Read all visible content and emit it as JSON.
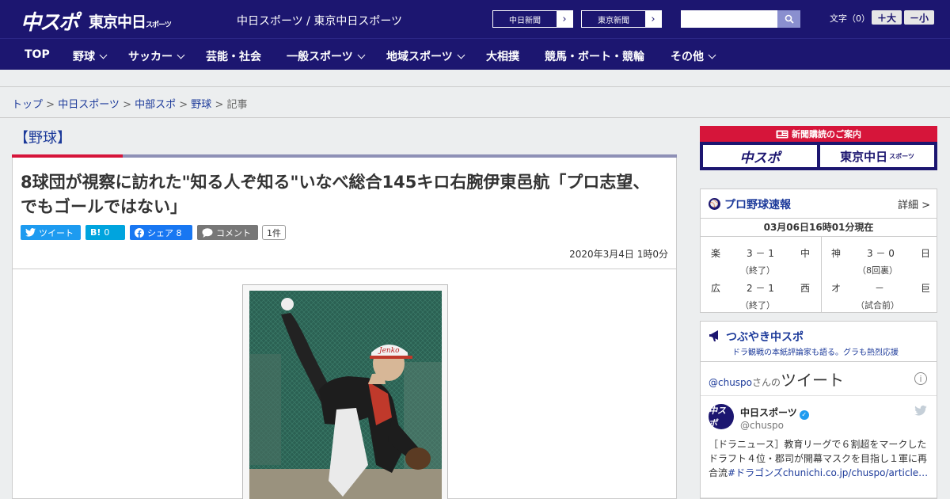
{
  "header": {
    "logo_primary": "中スポ",
    "logo_secondary": "東京中日",
    "logo_secondary_small": "スポーツ",
    "site_links": "中日スポーツ / 東京中日スポーツ",
    "btn_chunichi": "中日新聞",
    "btn_tokyo": "東京新聞",
    "search_placeholder": "",
    "font_size_label": "文字（0）",
    "font_plus": "＋大",
    "font_minus": "－小"
  },
  "nav": [
    {
      "label": "TOP",
      "dropdown": false
    },
    {
      "label": "野球",
      "dropdown": true
    },
    {
      "label": "サッカー",
      "dropdown": true
    },
    {
      "label": "芸能・社会",
      "dropdown": false
    },
    {
      "label": "一般スポーツ",
      "dropdown": true
    },
    {
      "label": "地域スポーツ",
      "dropdown": true
    },
    {
      "label": "大相撲",
      "dropdown": false
    },
    {
      "label": "競馬・ボート・競輪",
      "dropdown": false
    },
    {
      "label": "その他",
      "dropdown": true
    }
  ],
  "breadcrumb": {
    "items": [
      "トップ",
      "中日スポーツ",
      "中部スポ",
      "野球"
    ],
    "current": "記事",
    "sep": " > "
  },
  "article": {
    "category": "【野球】",
    "title": "8球団が視察に訪れた\"知る人ぞ知る\"いなべ総合145キロ右腕伊東邑航「プロ志望、でもゴールではない」",
    "share": {
      "tweet": "ツイート",
      "hatena_icon": "B!",
      "hatena_count": "0",
      "facebook": "シェア 8",
      "comment": "コメント",
      "comment_count": "1件"
    },
    "date": "2020年3月4日 1時0分",
    "photo_cap_text": "Jenko"
  },
  "sidebar": {
    "ad": {
      "top": "新聞購読のご案内",
      "left": "中スポ",
      "right": "東京中日",
      "right_small": "スポーツ"
    },
    "baseball": {
      "title": "プロ野球速報",
      "more": "詳細 >",
      "date": "03月06日16時01分現在",
      "games": [
        {
          "home": "楽",
          "score": "3 － 1",
          "away": "中",
          "status": "（終了）"
        },
        {
          "home": "神",
          "score": "3 － 0",
          "away": "日",
          "status": "（8回裏）"
        },
        {
          "home": "広",
          "score": "2 － 1",
          "away": "西",
          "status": "（終了）"
        },
        {
          "home": "オ",
          "score": "－",
          "away": "巨",
          "status": "（試合前）"
        }
      ]
    },
    "tweets": {
      "title": "つぶやき中スポ",
      "subtitle": "ドラ観戦の本紙評論家も語る。グラも熱烈応援",
      "handle_link": "@chuspo",
      "handle_mid": "さんの",
      "head_big": "ツイート",
      "avatar_text": "中スポ",
      "name": "中日スポーツ",
      "handle": "@chuspo",
      "text_main": "［ドラニュース］教育リーグで６割超をマークしたドラフト４位・郡司が開幕マスクを目指し１軍に再合流",
      "text_link": "#ドラゴンズchunichi.co.jp/chuspo/article…"
    }
  },
  "colors": {
    "navy": "#1c1670",
    "red": "#d6153a",
    "twitter": "#1d9bf0",
    "facebook": "#1877f2",
    "hatena": "#00a4de"
  }
}
